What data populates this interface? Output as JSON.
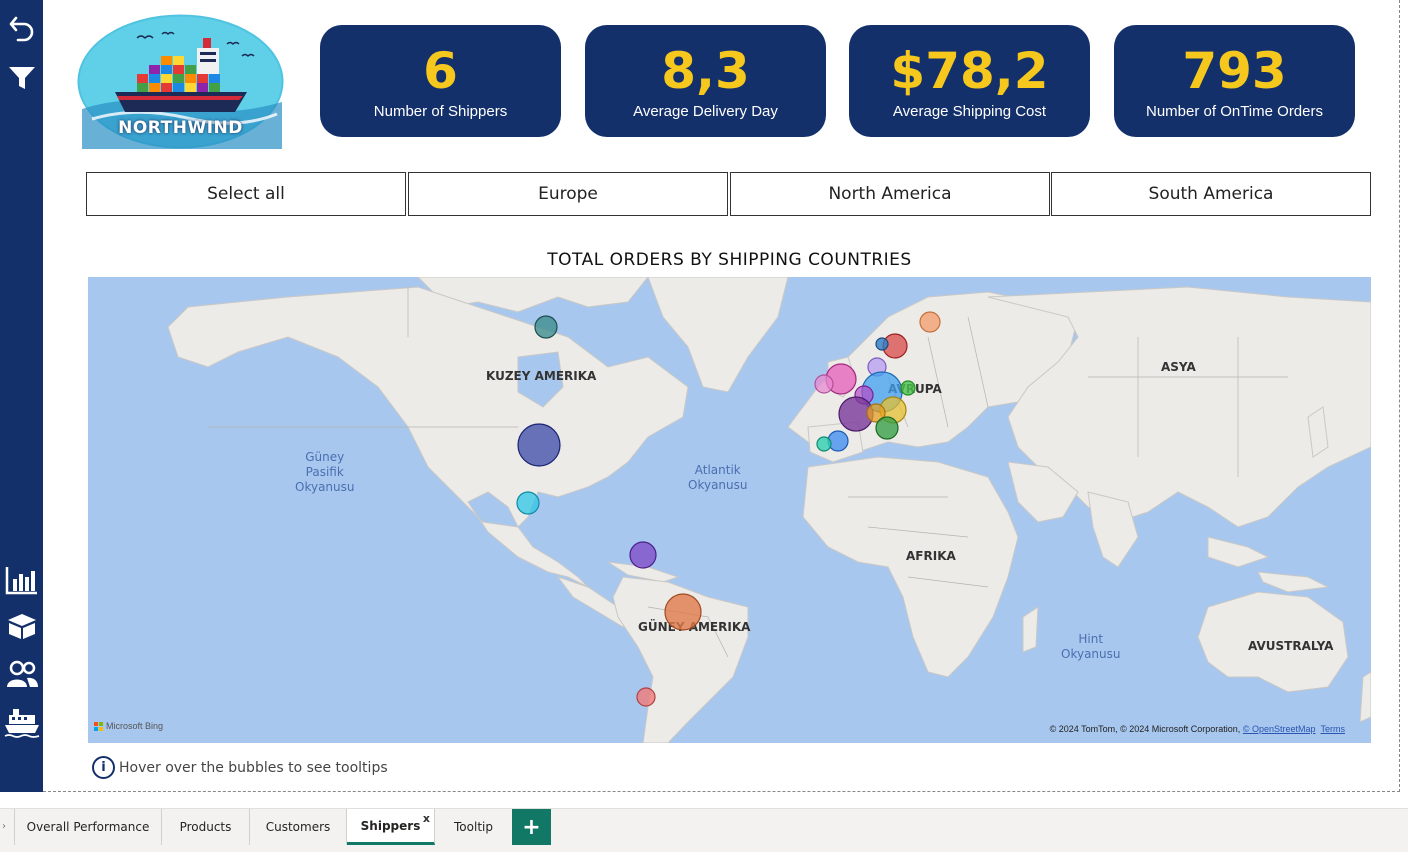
{
  "logo": {
    "text": "NORTHWIND"
  },
  "kpis": [
    {
      "value": "6",
      "label": "Number of Shippers"
    },
    {
      "value": "8,3",
      "label": "Average Delivery Day"
    },
    {
      "value": "$78,2",
      "label": "Average Shipping Cost"
    },
    {
      "value": "793",
      "label": "Number of OnTime Orders"
    }
  ],
  "slicer": [
    "Select all",
    "Europe",
    "North America",
    "South America"
  ],
  "map": {
    "title": "TOTAL ORDERS BY SHIPPING COUNTRIES",
    "continents": {
      "north_america": "KUZEY AMERIKA",
      "south_america": "GÜNEY AMERIKA",
      "europe": "AVRUPA",
      "asia": "ASYA",
      "africa": "AFRIKA",
      "australia": "AVUSTRALYA"
    },
    "oceans": {
      "pacific": "Güney\nPasifik\nOkyanusu",
      "atlantic": "Atlantik\nOkyanusu",
      "indian": "Hint\nOkyanusu"
    },
    "bing": "Microsoft Bing",
    "credits_text": "© 2024 TomTom, © 2024 Microsoft Corporation, ",
    "credits_osm": "© OpenStreetMap",
    "credits_terms": "Terms"
  },
  "hint": "Hover over the bubbles to see tooltips",
  "tabs": [
    {
      "label": "Overall Performance"
    },
    {
      "label": "Products"
    },
    {
      "label": "Customers"
    },
    {
      "label": "Shippers",
      "active": true,
      "close": "x"
    },
    {
      "label": "Tooltip"
    }
  ],
  "tab_add": "+",
  "colors": {
    "navy": "#14306b",
    "gold": "#f6c71d",
    "teal": "#117865"
  }
}
